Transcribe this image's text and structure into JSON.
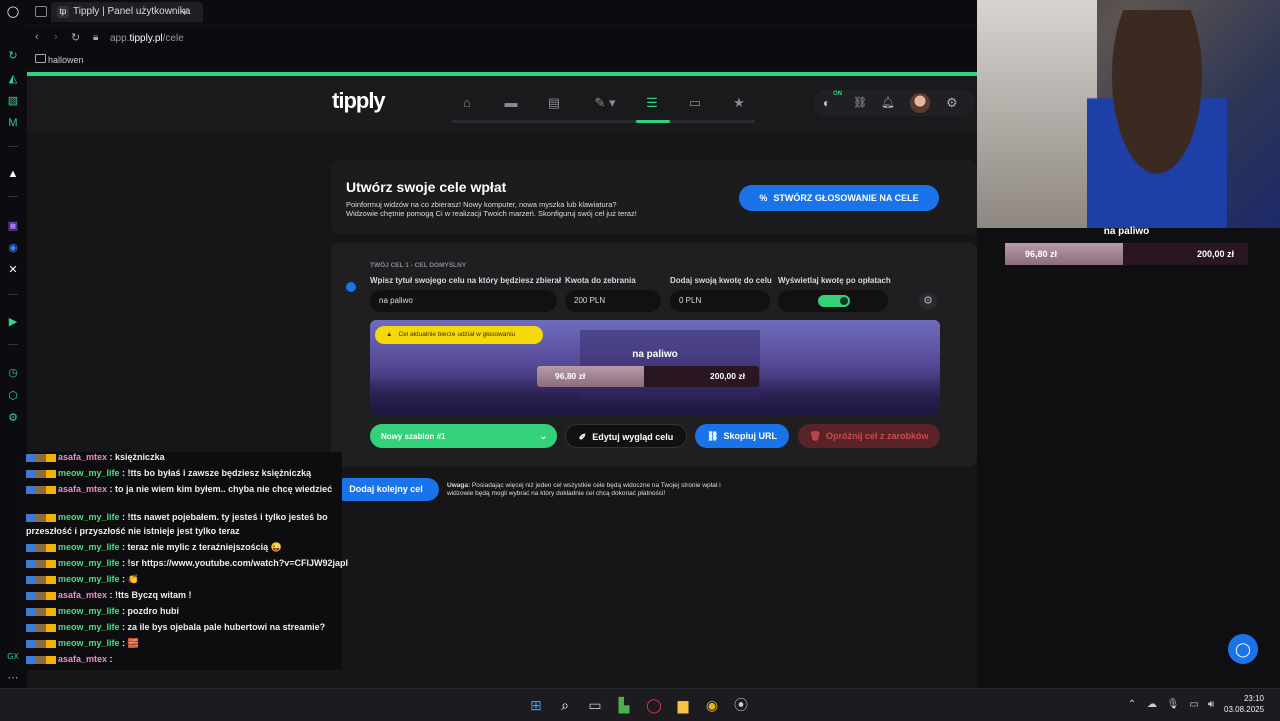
{
  "browser": {
    "tab_title": "Tipply | Panel użytkownika",
    "url_prefix": "app.",
    "url_domain": "tipply.pl",
    "url_path": "/cele",
    "bookmark": "hallowen"
  },
  "site": {
    "logo": "tipply",
    "nav_icons": [
      "home-icon",
      "inbox-icon",
      "wallet-icon",
      "edit-icon",
      "goals-icon",
      "window-icon",
      "star-icon"
    ],
    "notif_badge": "ON"
  },
  "hero": {
    "title": "Utwórz swoje cele wpłat",
    "desc_line1": "Poinformuj widzów na co zbierasz! Nowy komputer, nowa myszka lub klawiatura?",
    "desc_line2": "Widzowie chętnie pomogą Ci w realizacji Twoich marzeń. Skonfiguruj swój cel już teraz!",
    "vote_button": "STWÓRZ GŁOSOWANIE NA CELE"
  },
  "goal": {
    "header": "TWÓJ CEL 1 - CEL DOMYŚLNY",
    "title_label": "Wpisz tytuł swojego celu na który będziesz zbierał",
    "title_value": "na paliwo",
    "amount_label": "Kwota do zebrania",
    "amount_value": "200 PLN",
    "own_label": "Dodaj swoją kwotę do celu",
    "own_value": "0 PLN",
    "show_label": "Wyświetlaj kwotę po opłatach",
    "show_toggle_on": true,
    "warning": "Cel aktualnie bierze udział w głosowaniu",
    "preview_title": "na paliwo",
    "current": "96,80 zł",
    "target": "200,00 zł",
    "progress": 0.484,
    "template": "Nowy szablon #1",
    "edit_button": "Edytuj wygląd celu",
    "copy_button": "Skopiuj URL",
    "clear_button": "Opróżnij cel z zarobków"
  },
  "footer": {
    "add_button": "Dodaj kolejny cel",
    "note_bold": "Uwaga:",
    "note_line1": " Posiadając więcej niż jeden cel wszystkie cele będą widoczne na Twojej stronie wpłat i",
    "note_line2": "widzowie będą mogli wybrać na który dokładnie cel chcą dokonać płatności!"
  },
  "overlay": {
    "title": "na paliwo",
    "current": "96,80 zł",
    "target": "200,00 zł"
  },
  "chat": [
    {
      "user": "asafa_mtex",
      "color": "pink",
      "msg": " : księżniczka"
    },
    {
      "user": "meow_my_life",
      "color": "green",
      "msg": " : !tts bo byłaś i zawsze będziesz księżniczką"
    },
    {
      "user": "asafa_mtex",
      "color": "pink",
      "msg": " : to ja nie wiem kim byłem.. chyba nie chcę wiedzieć"
    },
    {
      "user": "meow_my_life",
      "color": "green",
      "msg": " : !tts nawet pojebałem. ty jesteś i tylko jesteś bo"
    },
    {
      "user": "",
      "color": "none",
      "msg": "przeszłość i przyszłość nie istnieje jest tylko teraz"
    },
    {
      "user": "meow_my_life",
      "color": "green",
      "msg": " : teraz nie mylic z teraźniejszością 😜"
    },
    {
      "user": "meow_my_life",
      "color": "green",
      "msg": " : !sr https://www.youtube.com/watch?v=CFlJW92japI"
    },
    {
      "user": "meow_my_life",
      "color": "green",
      "msg": " : 👏"
    },
    {
      "user": "asafa_mtex",
      "color": "pink",
      "msg": " : !tts Byczq witam !"
    },
    {
      "user": "meow_my_life",
      "color": "green",
      "msg": " : pozdro hubi"
    },
    {
      "user": "meow_my_life",
      "color": "green",
      "msg": " : za ile bys ojebala pale hubertowi na streamie?"
    },
    {
      "user": "meow_my_life",
      "color": "green",
      "msg": " : 🧱"
    },
    {
      "user": "asafa_mtex",
      "color": "pink",
      "msg": " :"
    }
  ],
  "taskbar": {
    "time": "23:10",
    "date": "03.08.2025"
  },
  "colors": {
    "accent_green": "#33d17a",
    "accent_blue": "#1a73e8",
    "danger_red": "#c0392b",
    "warning_yellow": "#f5d90a"
  }
}
